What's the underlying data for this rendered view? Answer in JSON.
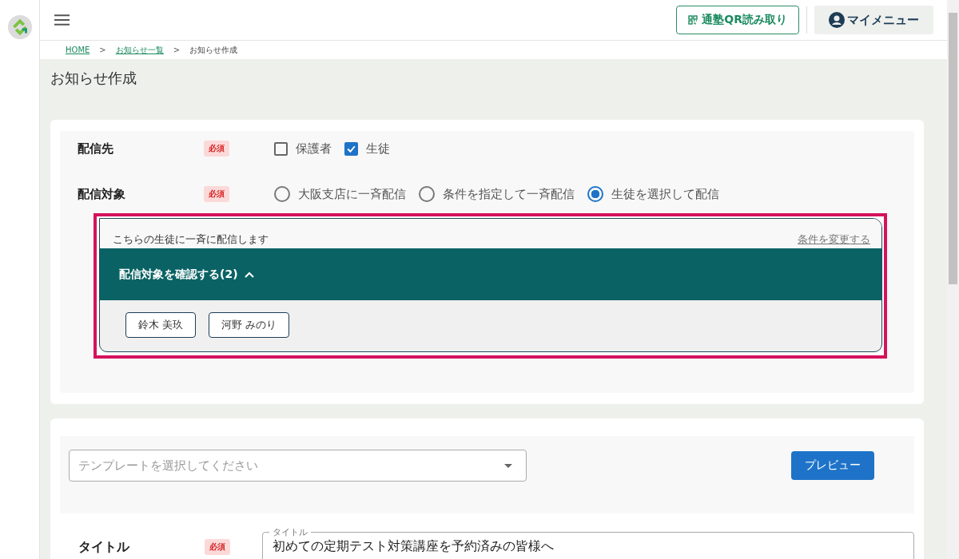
{
  "header": {
    "qr_button": "通塾QR読み取り",
    "my_menu": "マイメニュー"
  },
  "breadcrumb": [
    {
      "label": "HOME",
      "link": true
    },
    {
      "label": "お知らせ一覧",
      "link": true
    },
    {
      "label": "お知らせ作成",
      "link": false
    }
  ],
  "breadcrumb_separator": ">",
  "page_title": "お知らせ作成",
  "recipients": {
    "label": "配信先",
    "badge": "必須",
    "options": [
      {
        "label": "保護者",
        "checked": false
      },
      {
        "label": "生徒",
        "checked": true
      }
    ]
  },
  "target": {
    "label": "配信対象",
    "badge": "必須",
    "options": [
      {
        "label": "大阪支店に一斉配信",
        "selected": false
      },
      {
        "label": "条件を指定して一斉配信",
        "selected": false
      },
      {
        "label": "生徒を選択して配信",
        "selected": true
      }
    ]
  },
  "target_panel": {
    "note": "こちらの生徒に一斉に配信します",
    "change_link": "条件を変更する",
    "accordion": "配信対象を確認する(2)",
    "expanded": true,
    "students": [
      "鈴木 美玖",
      "河野 みのり"
    ]
  },
  "template": {
    "placeholder": "テンプレートを選択してください",
    "preview_button": "プレビュー"
  },
  "title_field": {
    "label": "タイトル",
    "badge": "必須",
    "floating_label": "タイトル",
    "value": "初めての定期テスト対策講座を予約済みの皆様へ"
  }
}
